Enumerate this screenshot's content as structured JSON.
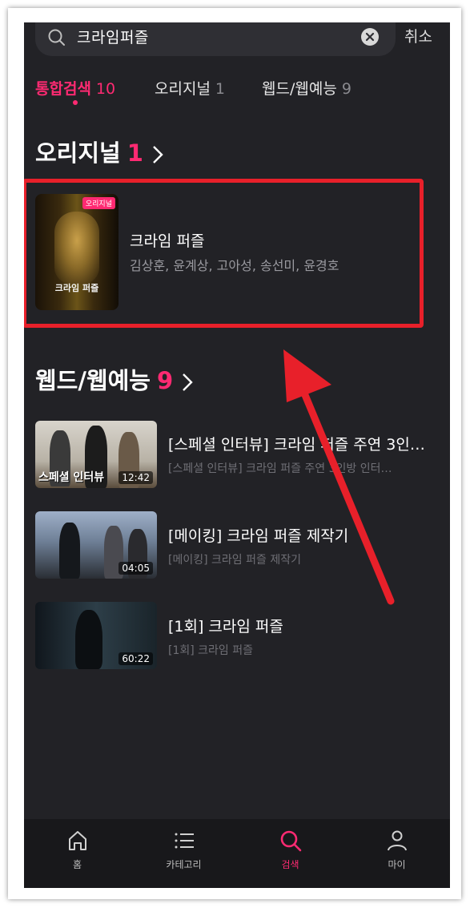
{
  "search": {
    "query": "크라임퍼즐",
    "cancel_label": "취소"
  },
  "tabs": [
    {
      "label": "통합검색",
      "count": "10",
      "active": true
    },
    {
      "label": "오리지널",
      "count": "1",
      "active": false
    },
    {
      "label": "웹드/웹예능",
      "count": "9",
      "active": false
    }
  ],
  "originals_section": {
    "title": "오리지널",
    "count": "1"
  },
  "original_item": {
    "badge": "오리지널",
    "poster_text": "크라임 퍼즐",
    "title": "크라임 퍼즐",
    "cast": "김상훈, 윤계상, 고아성, 송선미, 윤경호"
  },
  "webdrama_section": {
    "title": "웹드/웹예능",
    "count": "9"
  },
  "clips": [
    {
      "title": "[스페셜 인터뷰] 크라임 퍼즐 주연 3인…",
      "subtitle": "[스페셜 인터뷰] 크라임 퍼즐 주연 3인방 인터…",
      "duration": "12:42",
      "thumb_label": "스페셜 인터뷰"
    },
    {
      "title": "[메이킹] 크라임 퍼즐 제작기",
      "subtitle": "[메이킹] 크라임 퍼즐 제작기",
      "duration": "04:05"
    },
    {
      "title": "[1회] 크라임 퍼즐",
      "subtitle": "[1회] 크라임 퍼즐",
      "duration": "60:22"
    }
  ],
  "bottom_nav": [
    {
      "label": "홈",
      "icon": "home-icon"
    },
    {
      "label": "카테고리",
      "icon": "menu-icon"
    },
    {
      "label": "검색",
      "icon": "search-icon",
      "active": true
    },
    {
      "label": "마이",
      "icon": "person-icon"
    }
  ],
  "colors": {
    "accent": "#ff2a72",
    "background": "#222226",
    "annotation_red": "#e8202a"
  }
}
